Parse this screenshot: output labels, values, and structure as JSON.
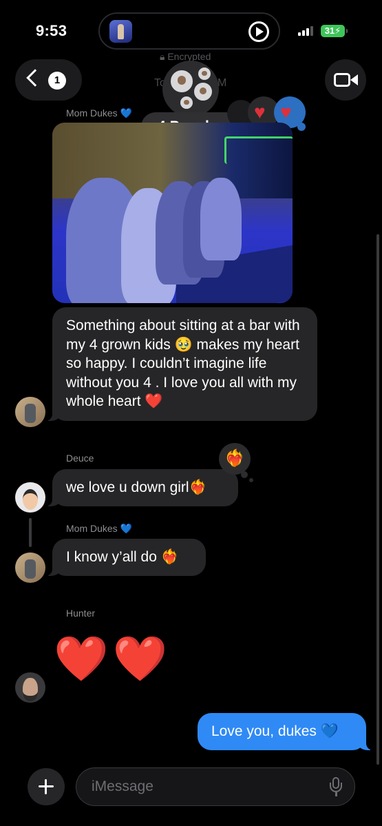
{
  "status_bar": {
    "time": "9:53",
    "battery": "31"
  },
  "header": {
    "encrypted_label": "Encrypted",
    "to_prefix": "To",
    "to_suffix": "M",
    "back_unread_count": "1",
    "group_label": "4 People"
  },
  "messages": [
    {
      "sender": "Mom Dukes",
      "sender_badge": "💙",
      "type": "photo"
    },
    {
      "sender": "Mom Dukes",
      "text": "Something about sitting at a bar with my 4 grown kids 🥹 makes my heart so happy. I couldn’t imagine life without you 4 . I love you all with my whole heart ❤️"
    },
    {
      "sender": "Deuce",
      "text": "we love u down girl❤️‍🔥",
      "tapback": "❤️‍🔥"
    },
    {
      "sender": "Mom Dukes",
      "sender_badge": "💙",
      "text": "I know y’all do ❤️‍🔥"
    },
    {
      "sender": "Hunter",
      "text": "❤️❤️"
    },
    {
      "sender": "me",
      "text": "Love you, dukes 💙"
    }
  ],
  "composer": {
    "placeholder": "iMessage"
  },
  "colors": {
    "background": "#000000",
    "incoming_bubble": "#262628",
    "outgoing_bubble": "#2f8af5",
    "battery": "#3fc55a"
  },
  "icons": [
    "play-circle-icon",
    "signal-icon",
    "back-chevron-icon",
    "video-camera-icon",
    "plus-icon",
    "microphone-icon",
    "lock-icon"
  ]
}
